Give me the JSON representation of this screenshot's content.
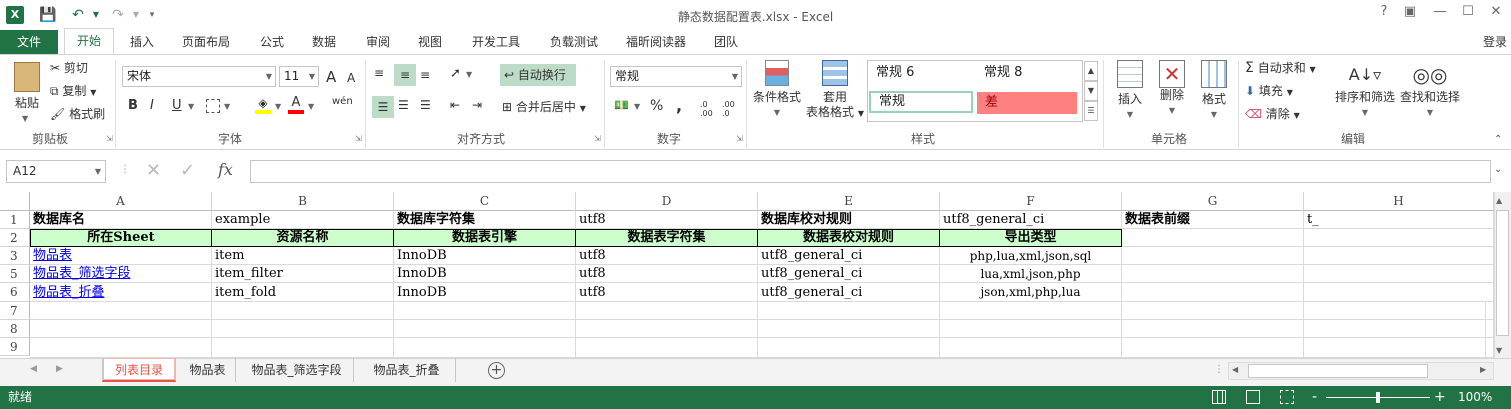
{
  "window": {
    "title": "静态数据配置表.xlsx - Excel",
    "help": "?",
    "user": "登录"
  },
  "menu": {
    "file": "文件",
    "tabs": [
      "开始",
      "插入",
      "页面布局",
      "公式",
      "数据",
      "审阅",
      "视图",
      "开发工具",
      "负载测试",
      "福昕阅读器",
      "团队"
    ]
  },
  "ribbon": {
    "clipboard": {
      "paste": "粘贴",
      "cut": "剪切",
      "copy": "复制",
      "format_painter": "格式刷",
      "label": "剪贴板"
    },
    "font": {
      "name": "宋体",
      "size": "11",
      "label": "字体",
      "bold": "B",
      "italic": "I",
      "underline": "U",
      "wen": "wén",
      "inc": "A",
      "dec": "A"
    },
    "alignment": {
      "wrap": "自动换行",
      "merge": "合并后居中",
      "label": "对齐方式"
    },
    "number": {
      "format": "常规",
      "label": "数字",
      "percent": "%",
      "comma": ","
    },
    "styles": {
      "cond": "条件格式",
      "table1": "套用",
      "table2": "表格格式",
      "normal6": "常规 6",
      "normal8": "常规 8",
      "normal": "常规",
      "bad": "差",
      "label": "样式"
    },
    "cells": {
      "insert": "插入",
      "delete": "删除",
      "format": "格式",
      "label": "单元格"
    },
    "editing": {
      "autosum": "自动求和",
      "fill": "填充",
      "clear": "清除",
      "sort": "排序和筛选",
      "find": "查找和选择",
      "label": "编辑"
    }
  },
  "formula": {
    "namebox": "A12",
    "fx": "fx",
    "value": ""
  },
  "columns": [
    "A",
    "B",
    "C",
    "D",
    "E",
    "F",
    "G",
    "H"
  ],
  "rows": [
    "1",
    "2",
    "3",
    "5",
    "6",
    "7",
    "8",
    "9"
  ],
  "sheet": {
    "r1": [
      "数据库名",
      "example",
      "数据库字符集",
      "utf8",
      "数据库校对规则",
      "utf8_general_ci",
      "数据表前缀",
      "t_"
    ],
    "r2": [
      "所在Sheet",
      "资源名称",
      "数据表引擎",
      "数据表字符集",
      "数据表校对规则",
      "导出类型"
    ],
    "r3": [
      "物品表",
      "item",
      "InnoDB",
      "utf8",
      "utf8_general_ci",
      "php,lua,xml,json,sql"
    ],
    "r5": [
      "物品表_筛选字段",
      "item_filter",
      "InnoDB",
      "utf8",
      "utf8_general_ci",
      "lua,xml,json,php"
    ],
    "r6": [
      "物品表_折叠",
      "item_fold",
      "InnoDB",
      "utf8",
      "utf8_general_ci",
      "json,xml,php,lua"
    ]
  },
  "sheet_tabs": [
    "列表目录",
    "物品表",
    "物品表_筛选字段",
    "物品表_折叠"
  ],
  "status": {
    "ready": "就绪",
    "zoom": "100%",
    "minus": "-",
    "plus": "+"
  },
  "colors": {
    "excel_green": "#217346",
    "header_fill": "#ccffcc",
    "bad_fill": "#ff8080",
    "active_tab": "#e2554a"
  }
}
